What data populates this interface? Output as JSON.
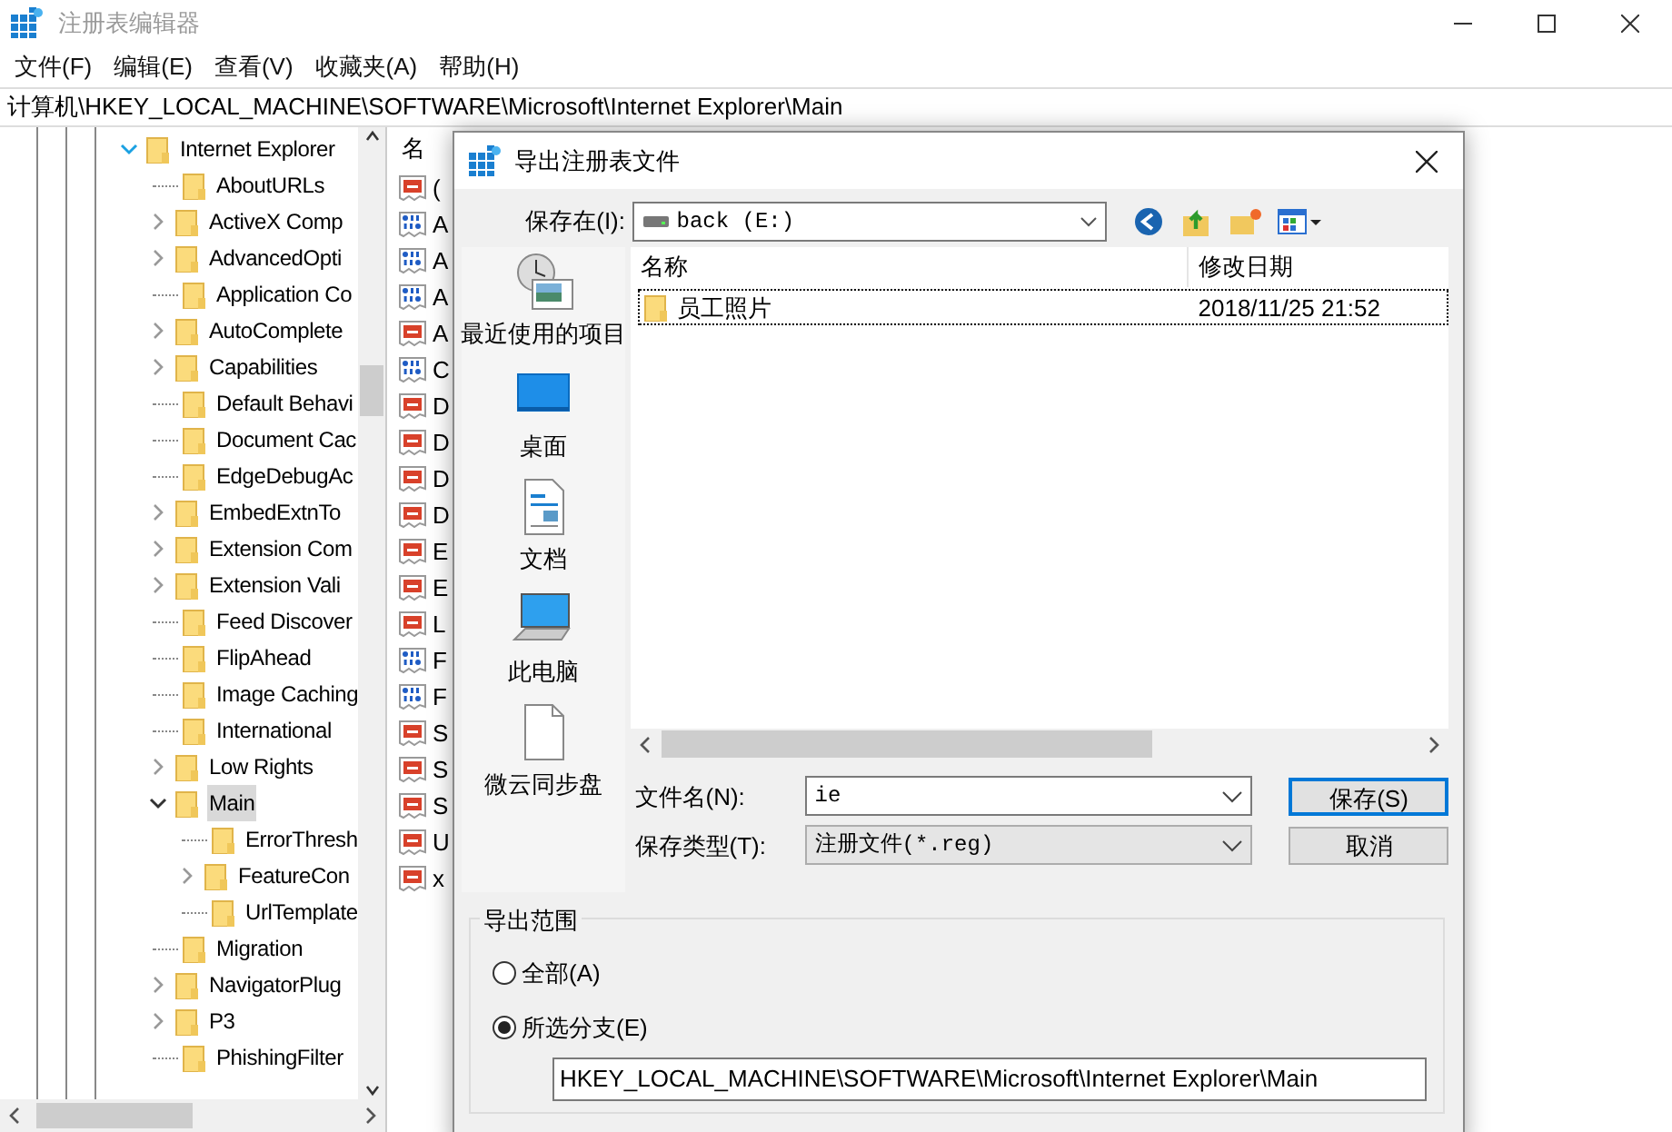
{
  "window": {
    "title": "注册表编辑器"
  },
  "menu": [
    "文件(F)",
    "编辑(E)",
    "查看(V)",
    "收藏夹(A)",
    "帮助(H)"
  ],
  "address": "计算机\\HKEY_LOCAL_MACHINE\\SOFTWARE\\Microsoft\\Internet Explorer\\Main",
  "tree": [
    {
      "label": "Internet Explorer",
      "expandable": true,
      "expanded": true,
      "selected": false,
      "children": [
        {
          "label": "AboutURLs",
          "expandable": false,
          "selected": false
        },
        {
          "label": "ActiveX Comp",
          "expandable": true,
          "expanded": false,
          "selected": false
        },
        {
          "label": "AdvancedOpti",
          "expandable": true,
          "expanded": false,
          "selected": false
        },
        {
          "label": "Application Co",
          "expandable": false,
          "selected": false
        },
        {
          "label": "AutoComplete",
          "expandable": true,
          "expanded": false,
          "selected": false
        },
        {
          "label": "Capabilities",
          "expandable": true,
          "expanded": false,
          "selected": false
        },
        {
          "label": "Default Behavi",
          "expandable": false,
          "selected": false
        },
        {
          "label": "Document Cac",
          "expandable": false,
          "selected": false
        },
        {
          "label": "EdgeDebugAc",
          "expandable": false,
          "selected": false
        },
        {
          "label": "EmbedExtnTo",
          "expandable": true,
          "expanded": false,
          "selected": false
        },
        {
          "label": "Extension Com",
          "expandable": true,
          "expanded": false,
          "selected": false
        },
        {
          "label": "Extension Vali",
          "expandable": true,
          "expanded": false,
          "selected": false
        },
        {
          "label": "Feed Discover",
          "expandable": false,
          "selected": false
        },
        {
          "label": "FlipAhead",
          "expandable": false,
          "selected": false
        },
        {
          "label": "Image Caching",
          "expandable": false,
          "selected": false
        },
        {
          "label": "International",
          "expandable": false,
          "selected": false
        },
        {
          "label": "Low Rights",
          "expandable": true,
          "expanded": false,
          "selected": false
        },
        {
          "label": "Main",
          "expandable": true,
          "expanded": true,
          "selected": true,
          "children": [
            {
              "label": "ErrorThresh",
              "expandable": false,
              "selected": false
            },
            {
              "label": "FeatureCon",
              "expandable": true,
              "expanded": false,
              "selected": false
            },
            {
              "label": "UrlTemplate",
              "expandable": false,
              "selected": false
            }
          ]
        },
        {
          "label": "Migration",
          "expandable": false,
          "selected": false
        },
        {
          "label": "NavigatorPlug",
          "expandable": true,
          "expanded": false,
          "selected": false
        },
        {
          "label": "P3",
          "expandable": true,
          "expanded": false,
          "selected": false
        },
        {
          "label": "PhishingFilter",
          "expandable": false,
          "selected": false
        }
      ]
    }
  ],
  "values": {
    "header": "名",
    "rows": [
      {
        "kind": "string",
        "name": "("
      },
      {
        "kind": "binary",
        "name": "A"
      },
      {
        "kind": "binary",
        "name": "A"
      },
      {
        "kind": "binary",
        "name": "A"
      },
      {
        "kind": "string",
        "name": "A"
      },
      {
        "kind": "binary",
        "name": "C"
      },
      {
        "kind": "string",
        "name": "D"
      },
      {
        "kind": "string",
        "name": "D"
      },
      {
        "kind": "string",
        "name": "D"
      },
      {
        "kind": "string",
        "name": "D"
      },
      {
        "kind": "string",
        "name": "E"
      },
      {
        "kind": "string",
        "name": "E"
      },
      {
        "kind": "string",
        "name": "L"
      },
      {
        "kind": "binary",
        "name": "F"
      },
      {
        "kind": "binary",
        "name": "F"
      },
      {
        "kind": "string",
        "name": "S"
      },
      {
        "kind": "string",
        "name": "S"
      },
      {
        "kind": "string",
        "name": "S"
      },
      {
        "kind": "string",
        "name": "U"
      },
      {
        "kind": "string",
        "name": "x"
      }
    ]
  },
  "dialog": {
    "title": "导出注册表文件",
    "save_in": {
      "label": "保存在(I):",
      "value": "back (E:)"
    },
    "places": [
      {
        "kind": "recent",
        "label": "最近使用的项目"
      },
      {
        "kind": "desktop",
        "label": "桌面"
      },
      {
        "kind": "documents",
        "label": "文档"
      },
      {
        "kind": "computer",
        "label": "此电脑"
      },
      {
        "kind": "cloud",
        "label": "微云同步盘"
      }
    ],
    "columns": [
      "名称",
      "修改日期"
    ],
    "files": [
      {
        "name": "员工照片",
        "date": "2018/11/25 21:52",
        "selected": true
      }
    ],
    "file_name": {
      "label": "文件名(N):",
      "value": "ie"
    },
    "file_type": {
      "label": "保存类型(T):",
      "value": "注册文件(*.reg)"
    },
    "buttons": [
      {
        "label": "保存(S)",
        "default": true
      },
      {
        "label": "取消",
        "default": false
      }
    ],
    "export_range": {
      "title": "导出范围",
      "options": [
        {
          "label": "全部(A)",
          "selected": false
        },
        {
          "label": "所选分支(E)",
          "selected": true
        }
      ],
      "path": "HKEY_LOCAL_MACHINE\\SOFTWARE\\Microsoft\\Internet Explorer\\Main"
    }
  }
}
